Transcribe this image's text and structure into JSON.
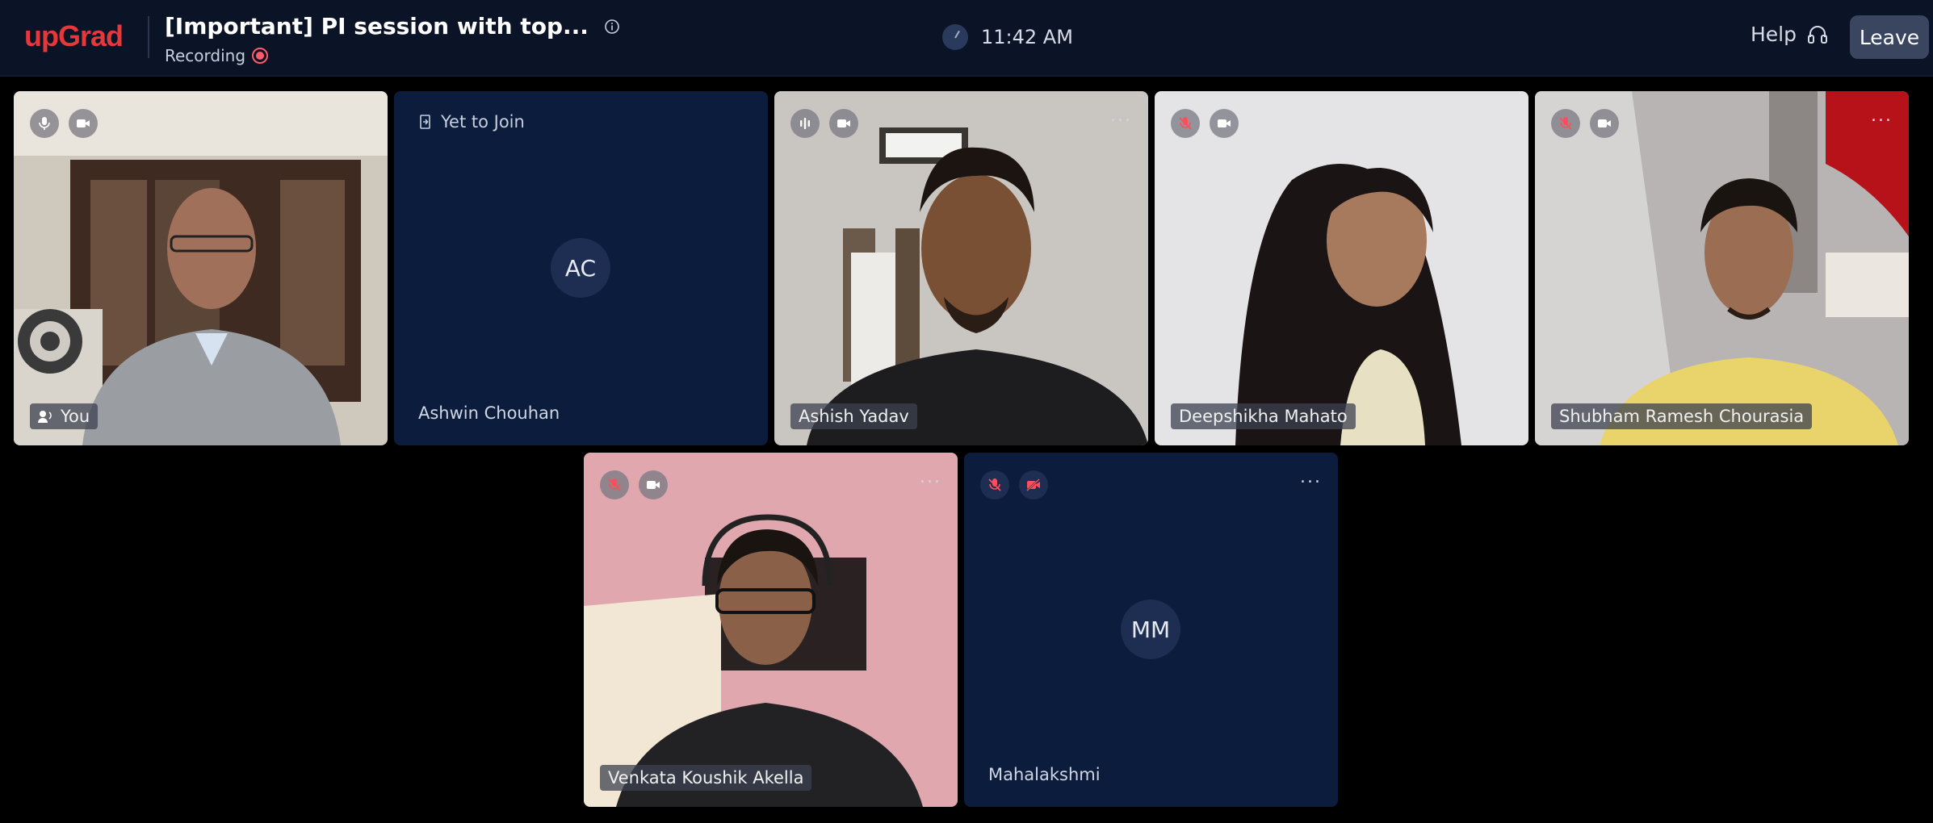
{
  "app": {
    "logo": "upGrad"
  },
  "session": {
    "title": "[Important] PI session with top...",
    "recording_label": "Recording",
    "time": "11:42 AM"
  },
  "header": {
    "help_label": "Help",
    "leave_label": "Leave"
  },
  "colors": {
    "brand": "#e5383b",
    "topbar_bg": "#0b1426",
    "tile_bg": "#0c1c3c",
    "recording": "#ff5a6a",
    "muted_mic": "#ff4d5a"
  },
  "participants": [
    {
      "name": "You",
      "video": true,
      "mic": "on",
      "icon": "speaker-icon"
    },
    {
      "name": "Ashwin Chouhan",
      "status": "Yet to Join",
      "initials": "AC"
    },
    {
      "name": "Ashish Yadav",
      "video": true,
      "mic": "speaking",
      "more": "..."
    },
    {
      "name": "Deepshikha Mahato",
      "video": true,
      "mic": "muted"
    },
    {
      "name": "Shubham Ramesh Chourasia",
      "video": true,
      "mic": "muted",
      "more": "..."
    },
    {
      "name": "Venkata Koushik Akella",
      "video": true,
      "mic": "muted",
      "more": "..."
    },
    {
      "name": "Mahalakshmi",
      "video": false,
      "mic": "muted",
      "initials": "MM",
      "more": "..."
    }
  ]
}
